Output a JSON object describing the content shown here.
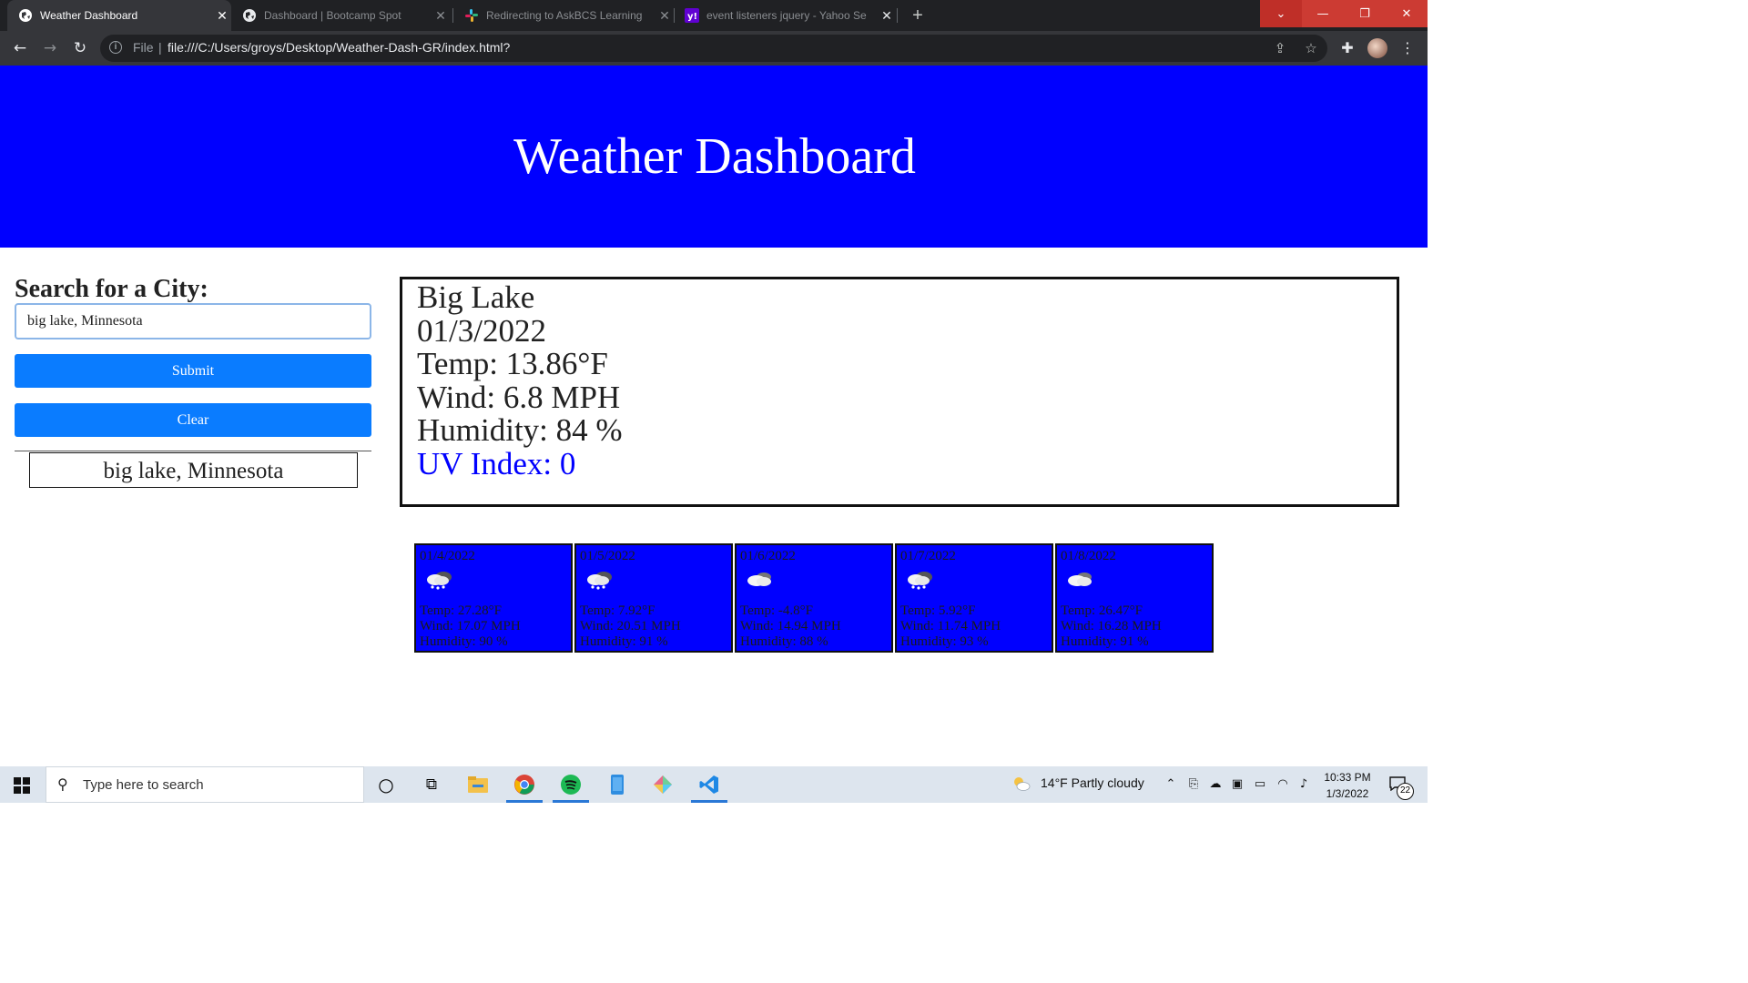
{
  "browser": {
    "tabs": [
      {
        "title": "Weather Dashboard",
        "active": true
      },
      {
        "title": "Dashboard | Bootcamp Spot",
        "active": false
      },
      {
        "title": "Redirecting to AskBCS Learning",
        "active": false
      },
      {
        "title": "event listeners jquery - Yahoo Se",
        "active": false
      }
    ],
    "address": {
      "scheme": "File",
      "separator": "|",
      "url": "file:///C:/Users/groys/Desktop/Weather-Dash-GR/index.html?"
    }
  },
  "page": {
    "header_title": "Weather Dashboard",
    "search": {
      "label": "Search for a City:",
      "input_value": "big lake, Minnesota",
      "submit_label": "Submit",
      "clear_label": "Clear",
      "history": [
        "big lake, Minnesota"
      ]
    },
    "current": {
      "city": "Big Lake",
      "date": "01/3/2022",
      "temp": "Temp: 13.86°F",
      "wind": "Wind: 6.8 MPH",
      "humidity": "Humidity: 84 %",
      "uv": "UV Index: 0",
      "uv_color": "#0000ff"
    },
    "forecast": [
      {
        "date": "01/4/2022",
        "icon": "snow-cloud-icon",
        "temp": "Temp: 27.28°F",
        "wind": "Wind: 17.07 MPH",
        "humidity": "Humidity: 90 %"
      },
      {
        "date": "01/5/2022",
        "icon": "snow-cloud-icon",
        "temp": "Temp: 7.92°F",
        "wind": "Wind: 20.51 MPH",
        "humidity": "Humidity: 91 %"
      },
      {
        "date": "01/6/2022",
        "icon": "cloud-icon",
        "temp": "Temp: -4.8°F",
        "wind": "Wind: 14.94 MPH",
        "humidity": "Humidity: 88 %"
      },
      {
        "date": "01/7/2022",
        "icon": "snow-cloud-icon",
        "temp": "Temp: 5.92°F",
        "wind": "Wind: 11.74 MPH",
        "humidity": "Humidity: 93 %"
      },
      {
        "date": "01/8/2022",
        "icon": "cloud-icon",
        "temp": "Temp: 26.47°F",
        "wind": "Wind: 16.28 MPH",
        "humidity": "Humidity: 91 %"
      }
    ],
    "colors": {
      "header_bg": "#0000ff",
      "button_bg": "#0a7cff",
      "card_bg": "#0000ff"
    }
  },
  "taskbar": {
    "search_placeholder": "Type here to search",
    "weather": "14°F  Partly cloudy",
    "time": "10:33 PM",
    "date": "1/3/2022",
    "notification_count": "22"
  }
}
